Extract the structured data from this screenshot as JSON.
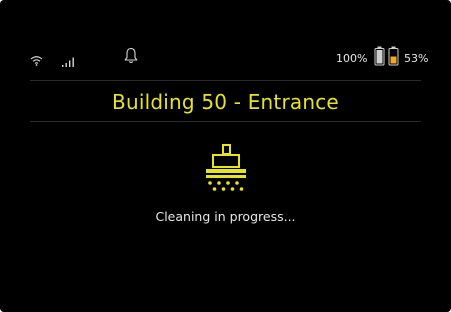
{
  "status_bar": {
    "wifi_icon": "wifi-icon",
    "signal_icon": "signal-icon",
    "notification_icon": "bell-icon",
    "device_battery_percent": "100%",
    "secondary_battery_percent": "53%",
    "device_battery_level": 1.0,
    "secondary_battery_level": 0.53
  },
  "location": {
    "title": "Building 50 - Entrance"
  },
  "activity": {
    "icon": "cleaning-machine-icon",
    "status": "Cleaning in progress..."
  },
  "colors": {
    "background": "#000000",
    "accent": "#e8e41c",
    "text": "#e6e6e6",
    "battery_warning": "#f5a623"
  }
}
